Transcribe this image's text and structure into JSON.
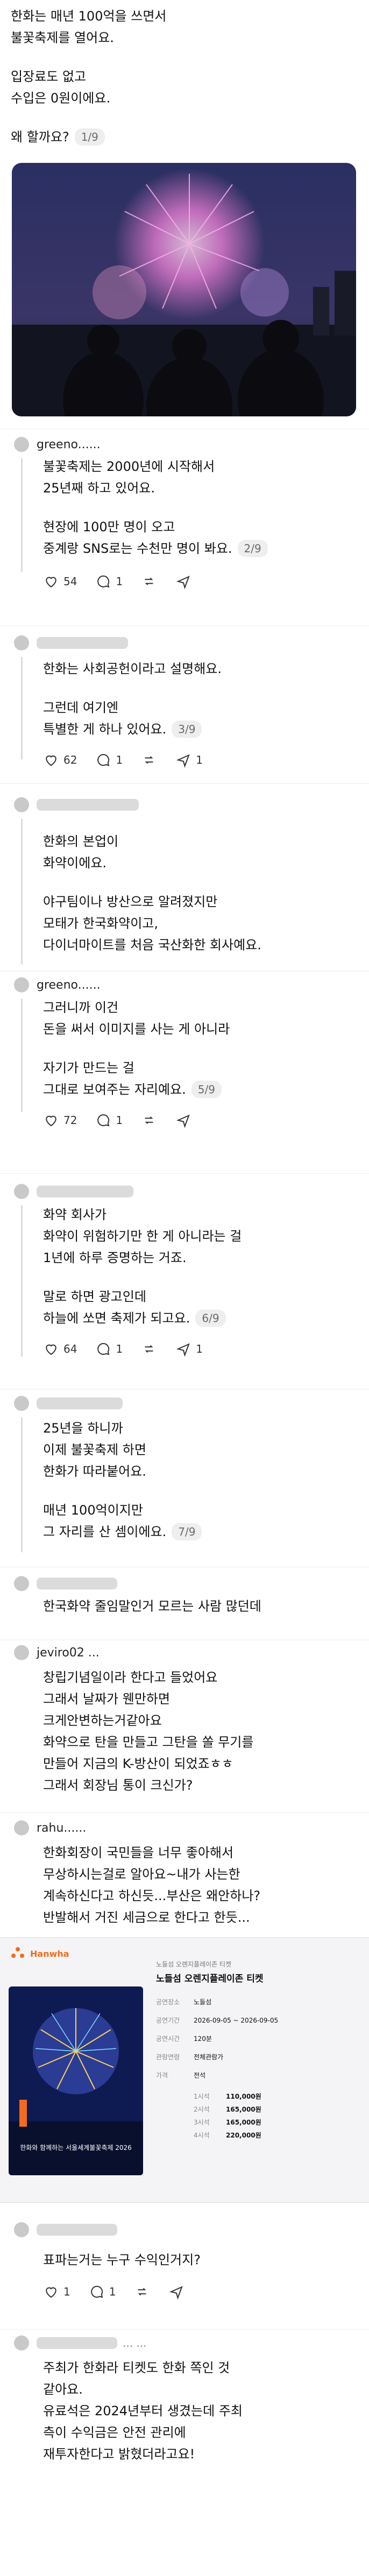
{
  "post1": {
    "lines": [
      "한화는 매년 100억을 쓰면서",
      "불꽃축제를 열어요.",
      "입장료도 없고",
      "수입은 0원이에요.",
      "왜 할까요?"
    ],
    "page": "1/9"
  },
  "post2": {
    "username": "greeno......",
    "lines": [
      "불꽃축제는 2000년에 시작해서",
      "25년째 하고 있어요.",
      "현장에 100만 명이 오고",
      "중계랑 SNS로는 수천만 명이 봐요."
    ],
    "page": "2/9",
    "likes": "54",
    "comments": "1"
  },
  "post3": {
    "lines": [
      "한화는 사회공헌이라고 설명해요.",
      "그런데 여기엔",
      "특별한 게 하나 있어요."
    ],
    "page": "3/9",
    "likes": "62",
    "comments": "1",
    "shares": "1"
  },
  "post4": {
    "lines": [
      "한화의 본업이",
      "화약이에요.",
      "야구팀이나 방산으로 알려졌지만",
      "모태가 한국화약이고,",
      "다이너마이트를 처음 국산화한 회사예요."
    ]
  },
  "post5": {
    "username": "greeno......",
    "lines": [
      "그러니까 이건",
      "돈을 써서 이미지를 사는 게 아니라",
      "자기가 만드는 걸",
      "그대로 보여주는 자리예요."
    ],
    "page": "5/9",
    "likes": "72",
    "comments": "1"
  },
  "post6": {
    "lines": [
      "화약 회사가",
      "화약이 위험하기만 한 게 아니라는 걸",
      "1년에 하루 증명하는 거죠.",
      "말로 하면 광고인데",
      "하늘에 쏘면 축제가 되고요."
    ],
    "page": "6/9",
    "likes": "64",
    "comments": "1",
    "shares": "1"
  },
  "post7": {
    "lines": [
      "25년을 하니까",
      "이제 불꽃축제 하면",
      "한화가 따라붙어요.",
      "매년 100억이지만",
      "그 자리를 산 셈이에요."
    ],
    "page": "7/9"
  },
  "post8": {
    "lines": [
      "한국화약 줄임말인거 모르는 사람 많던데"
    ]
  },
  "post9": {
    "username": "jeviro02 ...",
    "lines": [
      "창립기념일이라 한다고 들었어요",
      "그래서 날짜가 웬만하면",
      "크게안변하는거같아요",
      "화약으로 탄을 만들고 그탄을 쏠 무기를",
      "만들어 지금의 K-방산이 되었죠ㅎㅎ",
      "그래서 회장님 통이 크신가?"
    ]
  },
  "post10": {
    "username": "rahu......",
    "lines": [
      "한화회장이 국민들을 너무 좋아해서",
      "무상하시는걸로 알아요~내가 사는한",
      "계속하신다고 하신듯...부산은 왜안하나?",
      "반발해서 거진 세금으로 한다고 한듯..."
    ]
  },
  "ticket": {
    "brand": "Hanwha",
    "header": "노들섬 오렌지플레이존 티켓",
    "title": "노들섬 오렌지플레이존 티켓",
    "poster_title": "한화와 함께하는 서울세계불꽃축제 2026",
    "fields": [
      {
        "k": "공연장소",
        "v": "노들섬"
      },
      {
        "k": "공연기간",
        "v": "2026-09-05 ~ 2026-09-05"
      },
      {
        "k": "공연시간",
        "v": "120분"
      },
      {
        "k": "관람연령",
        "v": "전체관람가"
      },
      {
        "k": "가격",
        "v": "전석"
      }
    ],
    "prices": [
      {
        "k": "1시석",
        "v": "110,000원"
      },
      {
        "k": "2시석",
        "v": "165,000원"
      },
      {
        "k": "3시석",
        "v": "165,000원"
      },
      {
        "k": "4시석",
        "v": "220,000원"
      }
    ]
  },
  "post11": {
    "lines": [
      "표파는거는 누구 수익인거지?"
    ],
    "comments": "1",
    "likes": "1"
  },
  "post12": {
    "username": "... ...",
    "lines": [
      "주최가 한화라 티켓도 한화 쪽인 것",
      "같아요.",
      "유료석은 2024년부터 생겼는데 주최",
      "측이 수익금은 안전 관리에",
      "재투자한다고 밝혔더라고요!"
    ]
  },
  "icons": [
    "heart-icon",
    "comment-icon",
    "repost-icon",
    "share-icon"
  ],
  "colors": {
    "accent": "#f26b1d",
    "text": "#111111",
    "muted": "#6b6b6b"
  }
}
